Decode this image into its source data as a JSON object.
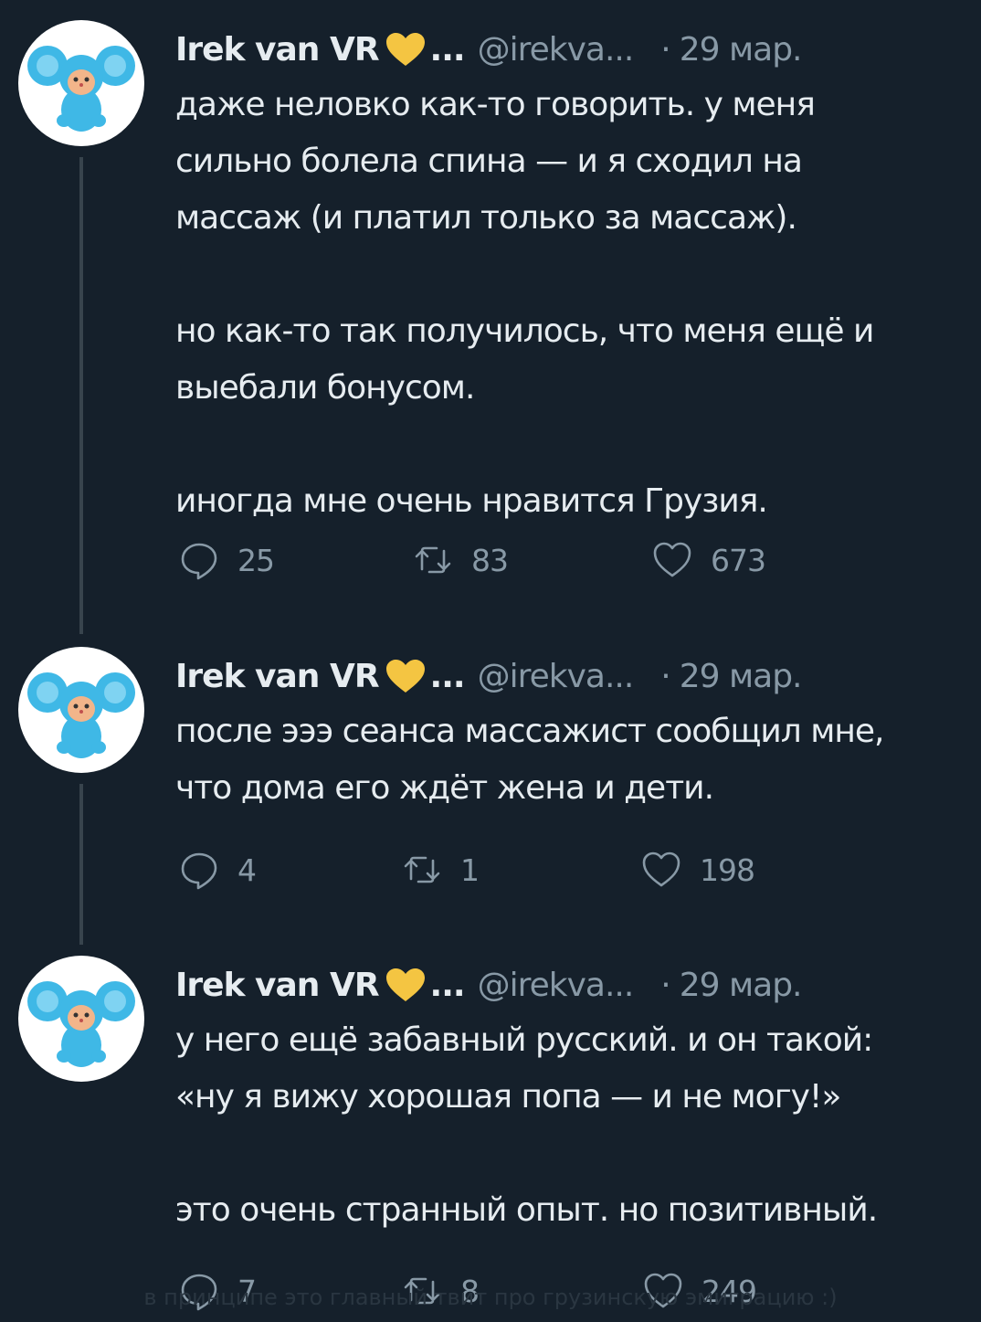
{
  "colors": {
    "background": "#15202b",
    "text": "#e6ecf0",
    "muted": "#8899a6",
    "thread_line": "#38444d",
    "heart_badge": "#f4c542",
    "avatar_figure": "#3fb8e6"
  },
  "tweets": [
    {
      "author": {
        "name": "Irek van VR",
        "badge_icon": "yellow-heart-icon",
        "ellipsis": "...",
        "handle": "@irekva...",
        "separator": "·",
        "date": "29 мар.",
        "avatar_icon": "cheburashka-avatar-icon"
      },
      "paragraphs": [
        [
          "даже неловко как-то говорить. у меня",
          "сильно болела спина — и я сходил на",
          "массаж (и платил только за массаж)."
        ],
        [
          "но как-то так получилось, что меня ещё и",
          "выебали бонусом."
        ],
        [
          "иногда мне очень нравится Грузия."
        ]
      ],
      "actions": {
        "replies": "25",
        "retweets": "83",
        "likes": "673"
      }
    },
    {
      "author": {
        "name": "Irek van VR",
        "badge_icon": "yellow-heart-icon",
        "ellipsis": "...",
        "handle": "@irekva...",
        "separator": "·",
        "date": "29 мар.",
        "avatar_icon": "cheburashka-avatar-icon"
      },
      "paragraphs": [
        [
          "после эээ сеанса массажист сообщил мне,",
          "что дома его ждёт жена и дети."
        ]
      ],
      "actions": {
        "replies": "4",
        "retweets": "1",
        "likes": "198"
      }
    },
    {
      "author": {
        "name": "Irek van VR",
        "badge_icon": "yellow-heart-icon",
        "ellipsis": "...",
        "handle": "@irekva...",
        "separator": "·",
        "date": "29 мар.",
        "avatar_icon": "cheburashka-avatar-icon"
      },
      "paragraphs": [
        [
          "у него ещё забавный русский. и он такой:",
          "«ну я вижу хорошая попа — и не могу!»"
        ],
        [
          "это очень странный опыт. но позитивный."
        ]
      ],
      "actions": {
        "replies": "7",
        "retweets": "8",
        "likes": "249"
      }
    }
  ],
  "caption": "в принципе это главный твит про грузинскую эмиграцию :)"
}
